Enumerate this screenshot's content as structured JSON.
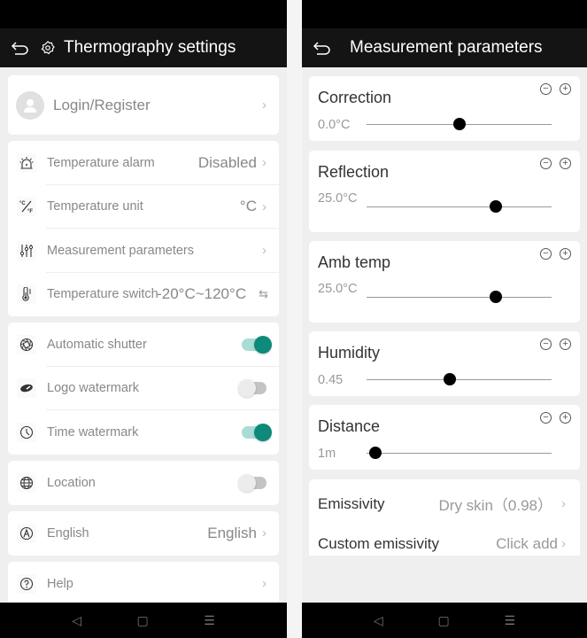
{
  "left_screen": {
    "title": "Thermography settings",
    "login": {
      "label": "Login/Register"
    },
    "group1": [
      {
        "icon": "alarm-icon",
        "label": "Temperature alarm",
        "value": "Disabled",
        "action": "chevron"
      },
      {
        "icon": "temp-unit-icon",
        "label": "Temperature unit",
        "value": "°C",
        "action": "chevron"
      },
      {
        "icon": "sliders-icon",
        "label": "Measurement parameters",
        "value": "",
        "action": "chevron"
      },
      {
        "icon": "thermometer-icon",
        "label": "Temperature switch",
        "value": "-20°C~120°C",
        "action": "swap"
      }
    ],
    "group2": [
      {
        "icon": "shutter-icon",
        "label": "Automatic shutter",
        "toggle": true
      },
      {
        "icon": "logo-icon",
        "label": "Logo watermark",
        "toggle": false
      },
      {
        "icon": "clock-icon",
        "label": "Time watermark",
        "toggle": true
      }
    ],
    "location": {
      "icon": "globe-icon",
      "label": "Location",
      "toggle": false
    },
    "language": {
      "icon": "language-icon",
      "label": "English",
      "value": "English"
    },
    "help": {
      "icon": "help-icon",
      "label": "Help"
    }
  },
  "right_screen": {
    "title": "Measurement parameters",
    "params": [
      {
        "name": "Correction",
        "value": "0.0°C",
        "slider_fraction": 0.5
      },
      {
        "name": "Reflection",
        "value": "25.0°C",
        "slider_fraction": 0.7
      },
      {
        "name": "Amb temp",
        "value": "25.0°C",
        "slider_fraction": 0.7
      },
      {
        "name": "Humidity",
        "value": "0.45",
        "slider_fraction": 0.45
      },
      {
        "name": "Distance",
        "value": "1m",
        "slider_fraction": 0.05
      }
    ],
    "emissivity": {
      "label": "Emissivity",
      "value": "Dry skin（0.98）"
    },
    "custom_emissivity": {
      "label": "Custom emissivity",
      "value": "Click add"
    }
  },
  "navbar": {
    "back": "◁",
    "home": "▢",
    "menu": "☰"
  },
  "colors": {
    "accent": "#0e8a7a",
    "accent_light": "#a8dcd4",
    "titlebar": "#141414"
  }
}
